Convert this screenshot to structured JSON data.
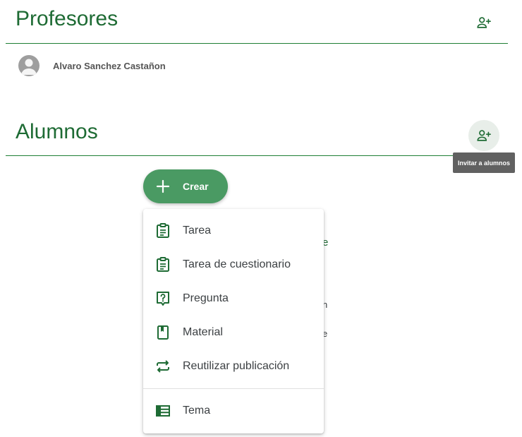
{
  "teachers": {
    "title": "Profesores",
    "add_icon": "person-add-icon",
    "list": [
      {
        "name": "Alvaro Sanchez Castañon",
        "avatar": "avatar-placeholder"
      }
    ]
  },
  "students": {
    "title": "Alumnos",
    "invite_icon": "person-add-icon",
    "invite_tooltip": "Invitar a alumnos"
  },
  "create_button": {
    "label": "Crear",
    "icon": "plus-icon"
  },
  "create_menu": {
    "items": [
      {
        "label": "Tarea",
        "icon": "assignment-icon"
      },
      {
        "label": "Tarea de cuestionario",
        "icon": "quiz-assignment-icon"
      },
      {
        "label": "Pregunta",
        "icon": "question-icon"
      },
      {
        "label": "Material",
        "icon": "book-icon"
      },
      {
        "label": "Reutilizar publicación",
        "icon": "repeat-icon"
      },
      {
        "label": "Tema",
        "icon": "topic-list-icon"
      }
    ]
  },
  "background_peek": {
    "a": "e",
    "b": "n",
    "c": "e"
  },
  "colors": {
    "accent": "#1e6b34",
    "fab": "#4a9a63",
    "tooltip": "#616161"
  }
}
